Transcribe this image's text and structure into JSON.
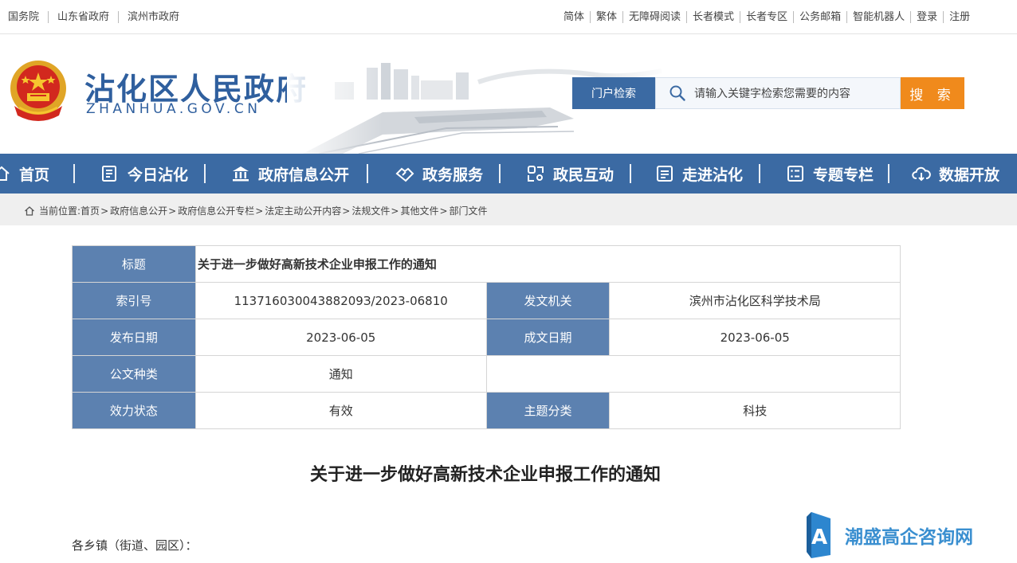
{
  "topbar": {
    "left_links": [
      "国务院",
      "山东省政府",
      "滨州市政府"
    ],
    "right_links": [
      "简体",
      "繁体",
      "无障碍阅读",
      "长者模式",
      "长者专区",
      "公务邮箱",
      "智能机器人",
      "登录",
      "注册"
    ]
  },
  "header": {
    "title": "沾化区人民政府",
    "subtitle": "ZHANHUA.GOV.CN",
    "search_label": "门户检索",
    "search_placeholder": "请输入关键字检索您需要的内容",
    "search_button": "搜 索"
  },
  "nav": {
    "items": [
      {
        "label": "首页",
        "icon": "home-icon"
      },
      {
        "label": "今日沾化",
        "icon": "newspaper-icon"
      },
      {
        "label": "政府信息公开",
        "icon": "government-building-icon"
      },
      {
        "label": "政务服务",
        "icon": "handshake-icon"
      },
      {
        "label": "政民互动",
        "icon": "interaction-icon"
      },
      {
        "label": "走进沾化",
        "icon": "document-list-icon"
      },
      {
        "label": "专题专栏",
        "icon": "column-list-icon"
      },
      {
        "label": "数据开放",
        "icon": "cloud-download-icon"
      }
    ]
  },
  "breadcrumb": {
    "prefix": "当前位置:",
    "items": [
      "首页",
      "政府信息公开",
      "政府信息公开专栏",
      "法定主动公开内容",
      "法规文件",
      "其他文件",
      "部门文件"
    ]
  },
  "info": {
    "title_label": "标题",
    "title_value": "关于进一步做好高新技术企业申报工作的通知",
    "index_label": "索引号",
    "index_value": "11371603004388209З/2023-06810",
    "issuer_label": "发文机关",
    "issuer_value": "滨州市沾化区科学技术局",
    "publish_label": "发布日期",
    "publish_value": "2023-06-05",
    "written_label": "成文日期",
    "written_value": "2023-06-05",
    "type_label": "公文种类",
    "type_value": "通知",
    "status_label": "效力状态",
    "status_value": "有效",
    "topic_label": "主题分类",
    "topic_value": "科技"
  },
  "document": {
    "title": "关于进一步做好高新技术企业申报工作的通知",
    "greeting": "各乡镇（街道、园区）："
  },
  "watermark": {
    "text": "潮盛高企咨询网"
  },
  "colors": {
    "nav_blue": "#3b6aa3",
    "label_blue": "#5c81b0",
    "search_orange": "#f08a1c",
    "title_blue": "#2f5f9e"
  }
}
